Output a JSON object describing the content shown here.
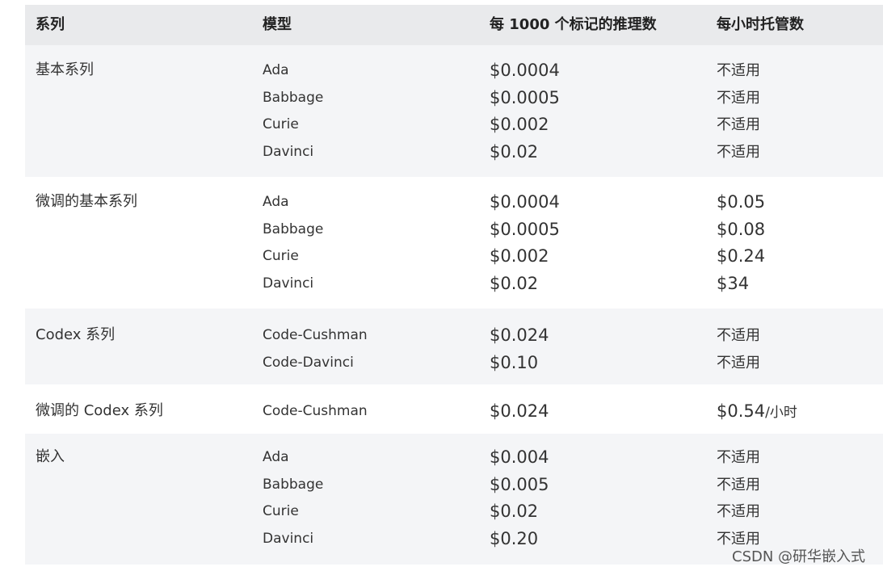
{
  "headers": [
    "系列",
    "模型",
    "每 1000 个标记的推理数",
    "每小时托管数"
  ],
  "groups": [
    {
      "series": "基本系列",
      "rows": [
        {
          "model": "Ada",
          "price": "$0.0004",
          "hosting": "不适用",
          "hosting_unit": ""
        },
        {
          "model": "Babbage",
          "price": "$0.0005",
          "hosting": "不适用",
          "hosting_unit": ""
        },
        {
          "model": "Curie",
          "price": "$0.002",
          "hosting": "不适用",
          "hosting_unit": ""
        },
        {
          "model": "Davinci",
          "price": "$0.02",
          "hosting": "不适用",
          "hosting_unit": ""
        }
      ]
    },
    {
      "series": "微调的基本系列",
      "rows": [
        {
          "model": "Ada",
          "price": "$0.0004",
          "hosting": "$0.05",
          "hosting_unit": ""
        },
        {
          "model": "Babbage",
          "price": "$0.0005",
          "hosting": "$0.08",
          "hosting_unit": ""
        },
        {
          "model": "Curie",
          "price": "$0.002",
          "hosting": "$0.24",
          "hosting_unit": ""
        },
        {
          "model": "Davinci",
          "price": "$0.02",
          "hosting": "$34",
          "hosting_unit": ""
        }
      ]
    },
    {
      "series": "Codex 系列",
      "rows": [
        {
          "model": "Code-Cushman",
          "price": "$0.024",
          "hosting": "不适用",
          "hosting_unit": ""
        },
        {
          "model": "Code-Davinci",
          "price": "$0.10",
          "hosting": "不适用",
          "hosting_unit": ""
        }
      ]
    },
    {
      "series": "微调的 Codex 系列",
      "rows": [
        {
          "model": "Code-Cushman",
          "price": "$0.024",
          "hosting": "$0.54",
          "hosting_unit": "/小时"
        }
      ]
    },
    {
      "series": "嵌入",
      "rows": [
        {
          "model": "Ada",
          "price": "$0.004",
          "hosting": "不适用",
          "hosting_unit": ""
        },
        {
          "model": "Babbage",
          "price": "$0.005",
          "hosting": "不适用",
          "hosting_unit": ""
        },
        {
          "model": "Curie",
          "price": "$0.02",
          "hosting": "不适用",
          "hosting_unit": ""
        },
        {
          "model": "Davinci",
          "price": "$0.20",
          "hosting": "不适用",
          "hosting_unit": ""
        }
      ]
    }
  ],
  "watermark": "CSDN @研华嵌入式"
}
